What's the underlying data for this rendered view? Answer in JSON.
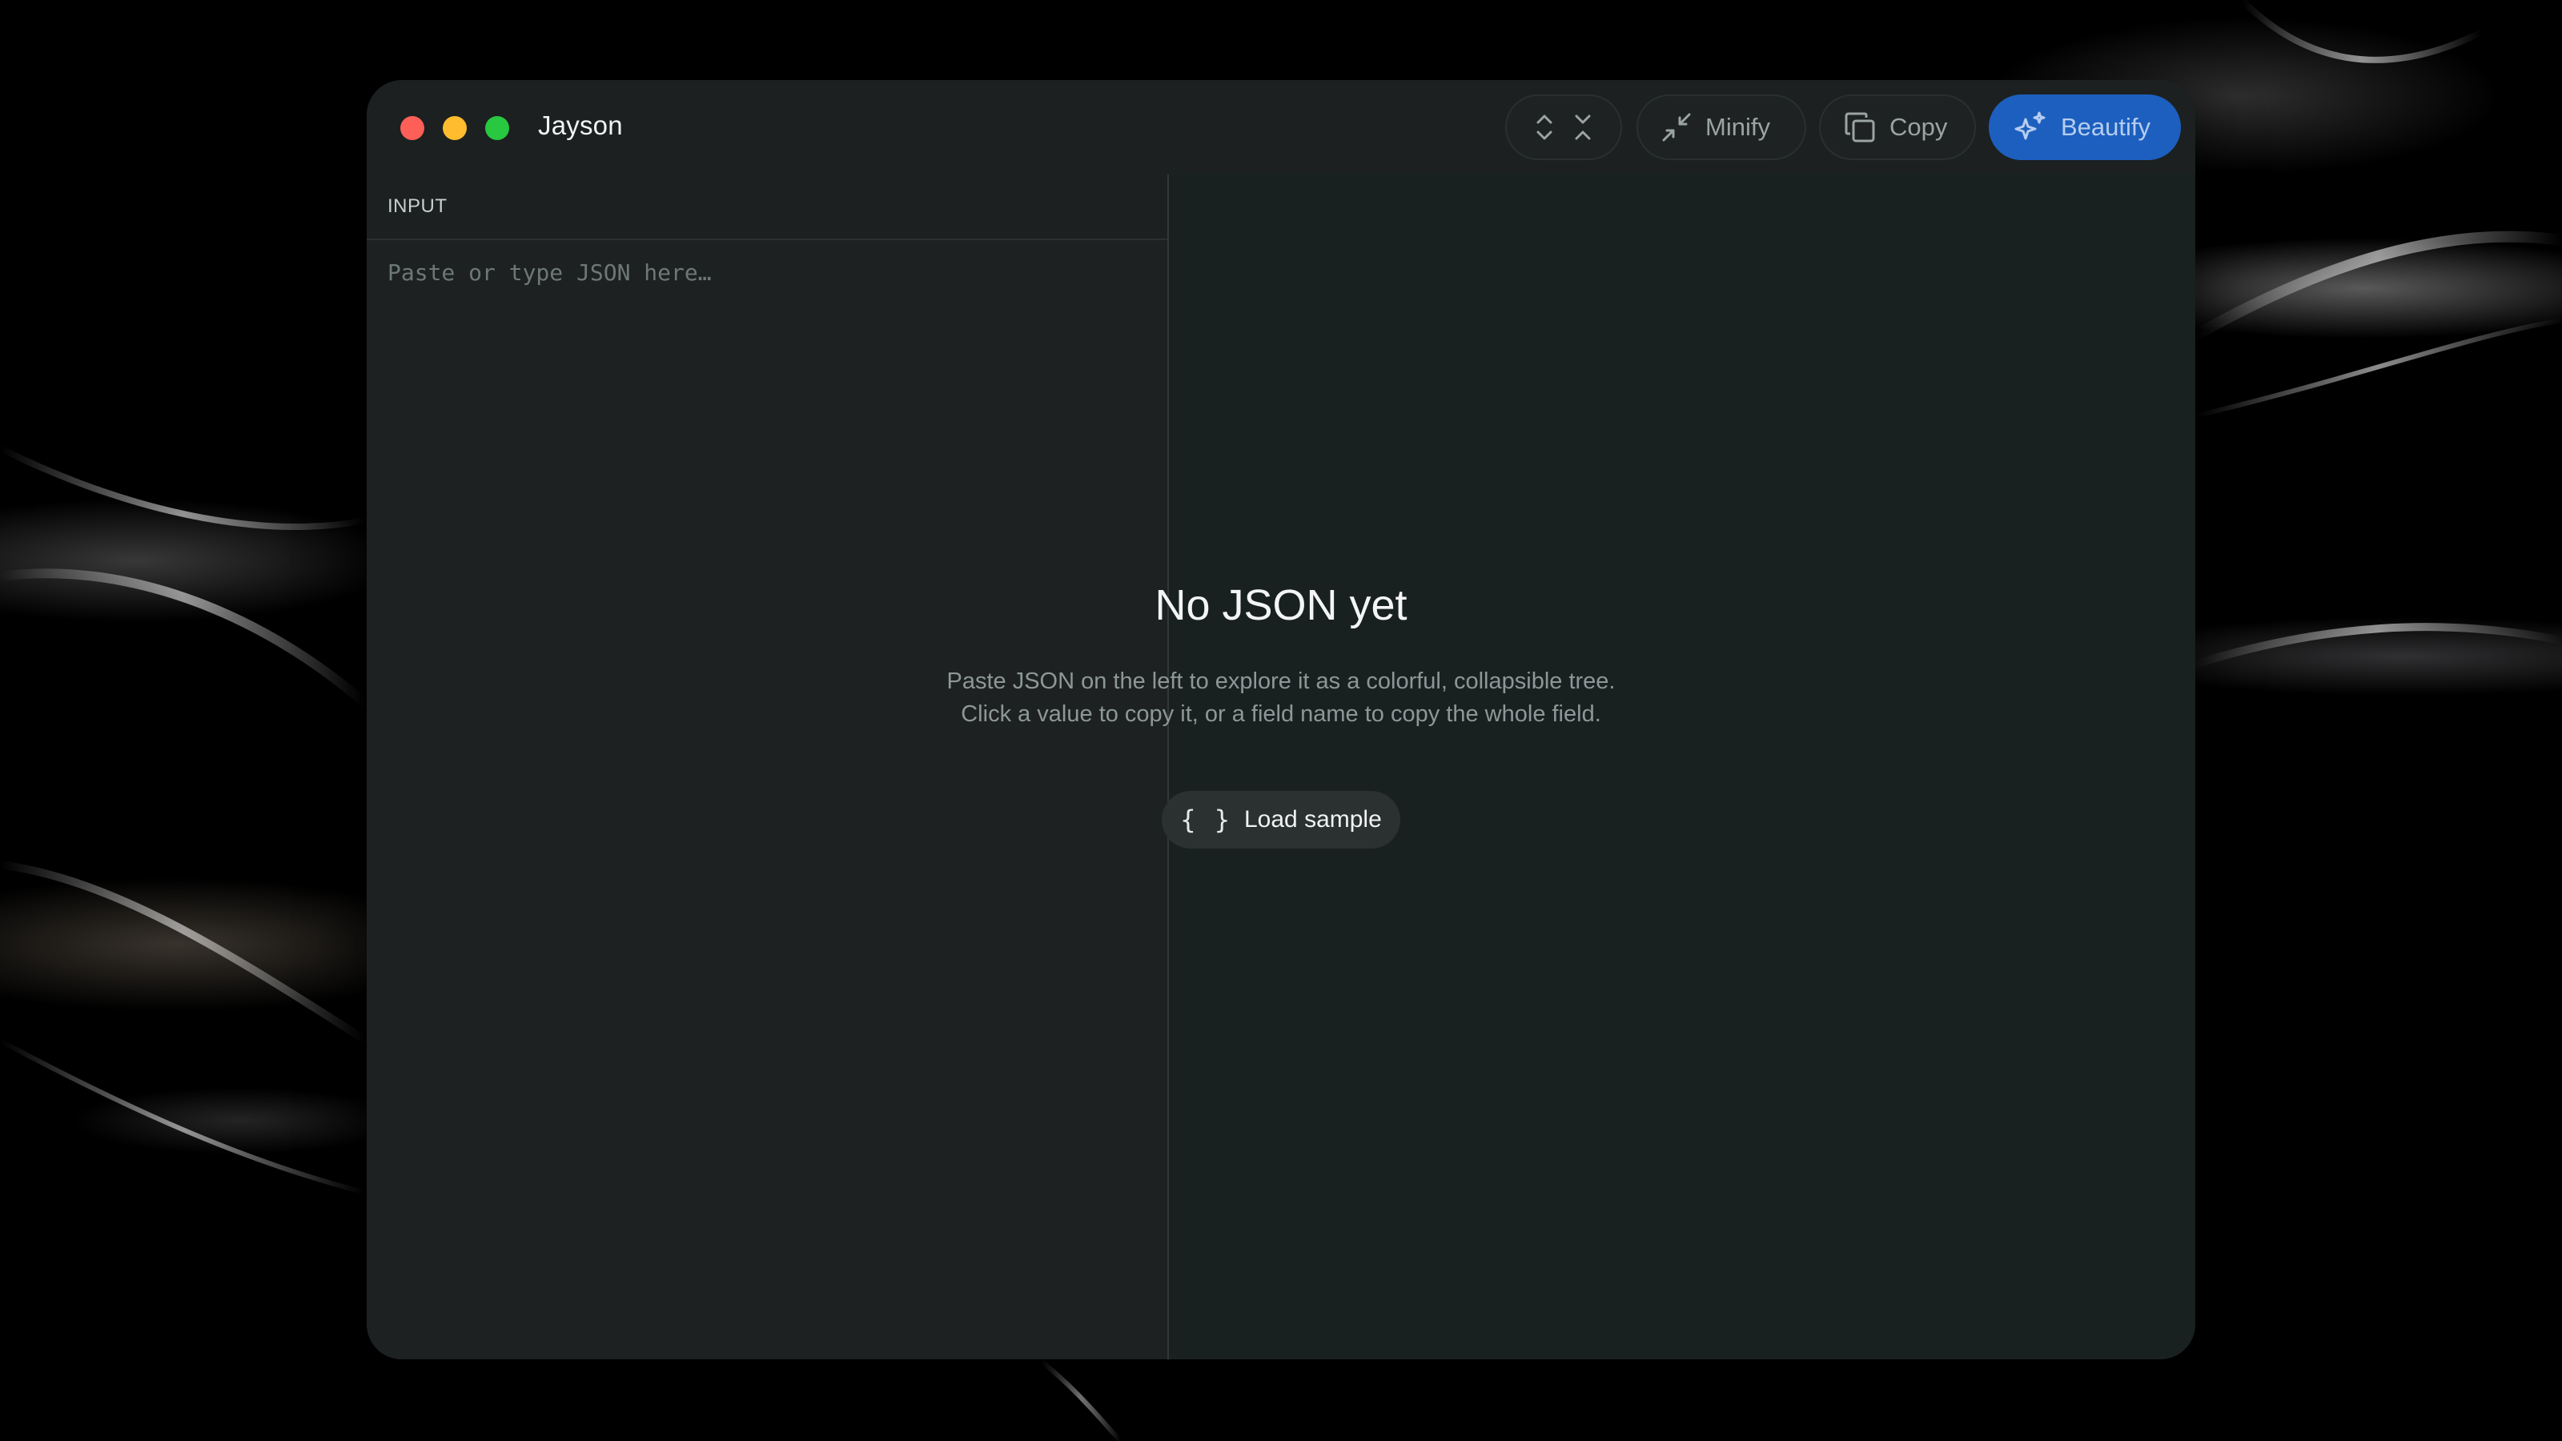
{
  "window": {
    "title": "Jayson",
    "controls": {
      "close": "close-icon",
      "minimize": "minimize-icon",
      "zoom": "zoom-icon"
    }
  },
  "toolbar": {
    "expand_all_icon": "chevrons-expand-icon",
    "collapse_all_icon": "chevrons-collapse-icon",
    "minify_label": "Minify",
    "minify_icon": "arrows-minimize-icon",
    "copy_label": "Copy",
    "copy_icon": "copy-icon",
    "beautify_label": "Beautify",
    "beautify_icon": "sparkles-icon",
    "accent_color": "#1d5fbf"
  },
  "input_pane": {
    "header": "INPUT",
    "value": "",
    "placeholder": "Paste or type JSON here…"
  },
  "empty_state": {
    "title": "No JSON yet",
    "description": "Paste JSON on the left to explore it as a colorful, collapsible tree. Click a value to copy it, or a field name to copy the whole field.",
    "load_sample_label": "Load sample",
    "load_sample_icon": "braces-icon"
  }
}
